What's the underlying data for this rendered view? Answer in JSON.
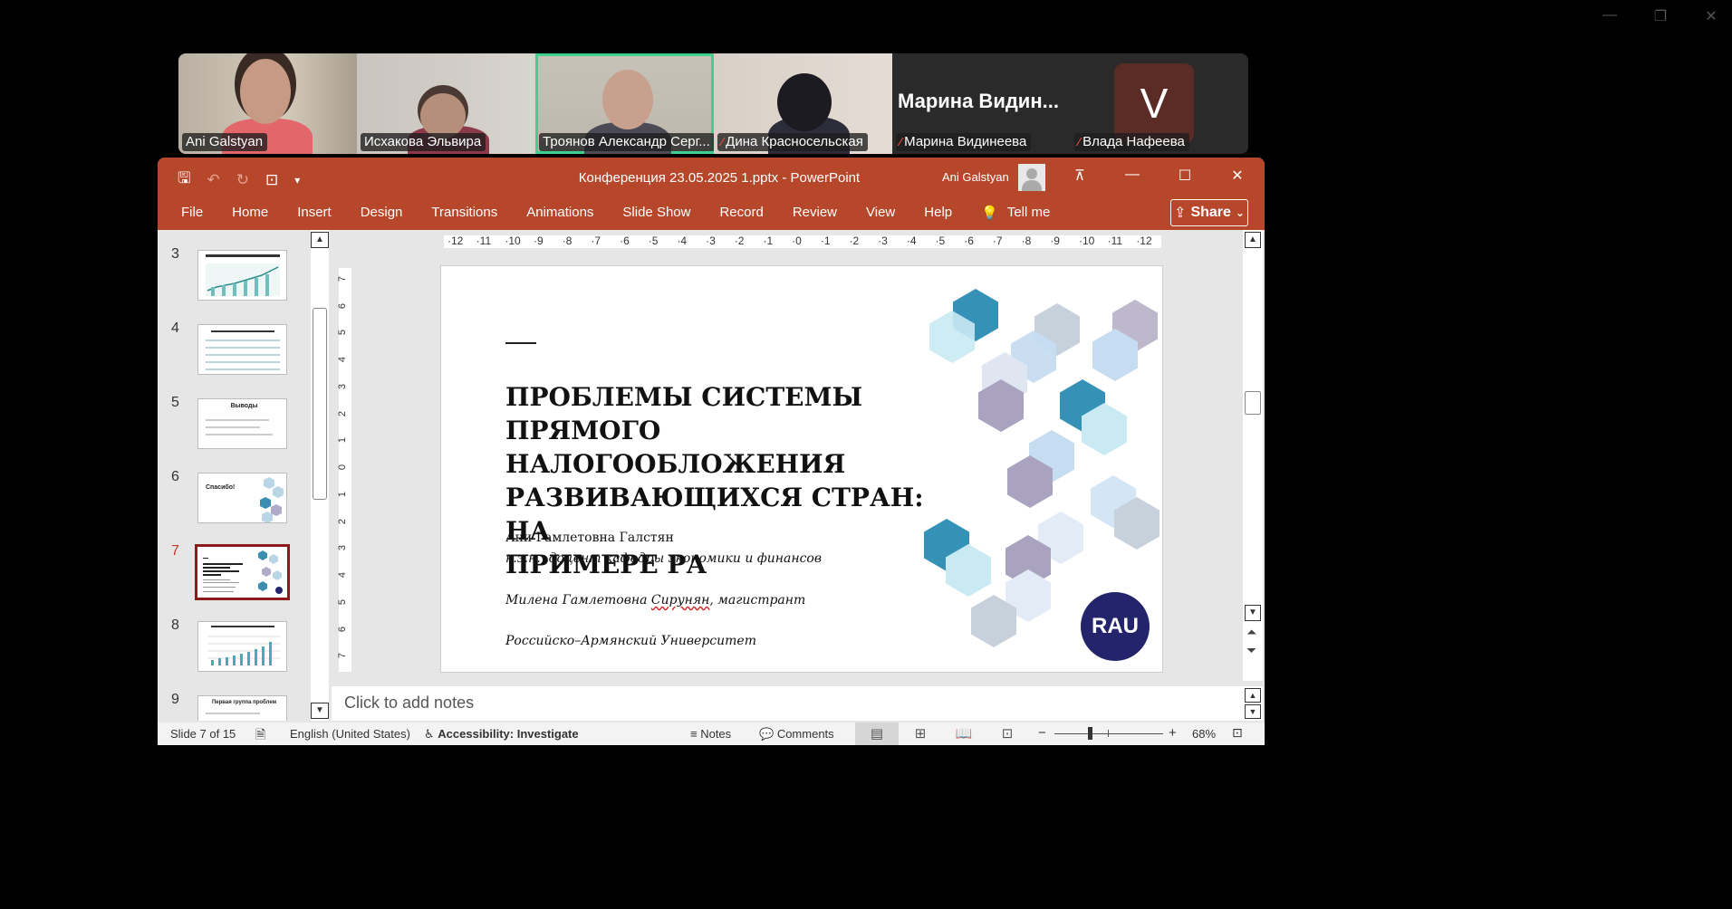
{
  "outer_window": {
    "minimize": "—",
    "restore": "❐",
    "close": "✕"
  },
  "participants": [
    {
      "name": "Ani Galstyan",
      "muted": false,
      "mic": ""
    },
    {
      "name": "Исхакова Эльвира",
      "muted": false,
      "mic": ""
    },
    {
      "name": "Троянов Александр Серг...",
      "muted": false,
      "mic": "",
      "active": true
    },
    {
      "name": "Дина Красносельская",
      "muted": true,
      "mic": "⁄"
    },
    {
      "name": "Марина Видинеева",
      "muted": true,
      "mic": "⁄",
      "display_name": "Марина  Видин..."
    },
    {
      "name": "Влада Нафеева",
      "muted": true,
      "mic": "⁄",
      "initial": "V"
    }
  ],
  "ppt": {
    "title": "Конференция 23.05.2025 1.pptx  -  PowerPoint",
    "user": "Ani Galstyan",
    "accent_color": "#b7472a",
    "qat": {
      "save": "🖫",
      "undo": "↶",
      "redo": "↻",
      "present": "⊡",
      "more": "▾"
    },
    "window_controls": {
      "ribbon": "⊼",
      "minimize": "—",
      "maximize": "☐",
      "close": "✕"
    },
    "menu": [
      "File",
      "Home",
      "Insert",
      "Design",
      "Transitions",
      "Animations",
      "Slide Show",
      "Record",
      "Review",
      "View",
      "Help",
      "Tell me"
    ],
    "tell_me_icon": "💡",
    "share_label": "Share",
    "share_icon": "⇪",
    "share_chevron": "⌄",
    "thumbnails": [
      {
        "num": "3",
        "title": ""
      },
      {
        "num": "4",
        "title": ""
      },
      {
        "num": "5",
        "title": "Выводы"
      },
      {
        "num": "6",
        "title": "Спасибо!"
      },
      {
        "num": "7",
        "title": "",
        "selected": true
      },
      {
        "num": "8",
        "title": ""
      },
      {
        "num": "9",
        "title": "Первая группа проблем"
      }
    ],
    "ruler_h": [
      "12",
      "11",
      "10",
      "9",
      "8",
      "7",
      "6",
      "5",
      "4",
      "3",
      "2",
      "1",
      "0",
      "1",
      "2",
      "3",
      "4",
      "5",
      "6",
      "7",
      "8",
      "9",
      "10",
      "11",
      "12"
    ],
    "ruler_v": [
      "7",
      "6",
      "5",
      "4",
      "3",
      "2",
      "1",
      "0",
      "1",
      "2",
      "3",
      "4",
      "5",
      "6",
      "7"
    ],
    "slide": {
      "title": "ПРОБЛЕМЫ СИСТЕМЫ ПРЯМОГО\nНАЛОГООБЛОЖЕНИЯ\nРАЗВИВАЮЩИХСЯ СТРАН: НА\nПРИМЕРЕ РА",
      "author": "Ани Гамлетовна Галстян",
      "position": "к.э.н., доцент кафедры экономики и финансов",
      "coauthor_name": "Милена Гамлетовна ",
      "coauthor_surname": "Сирунян",
      "coauthor_role": ", магистрант",
      "university": "Российско–Армянский Университет",
      "logo_text": "RAU"
    },
    "notes_placeholder": "Click to add notes",
    "status": {
      "slide_info": "Slide 7 of 15",
      "language": "English (United States)",
      "accessibility": "Accessibility: Investigate",
      "notes": "Notes",
      "comments": "Comments",
      "zoom": "68%",
      "zoom_minus": "−",
      "zoom_plus": "+",
      "fit": "⊡"
    }
  }
}
